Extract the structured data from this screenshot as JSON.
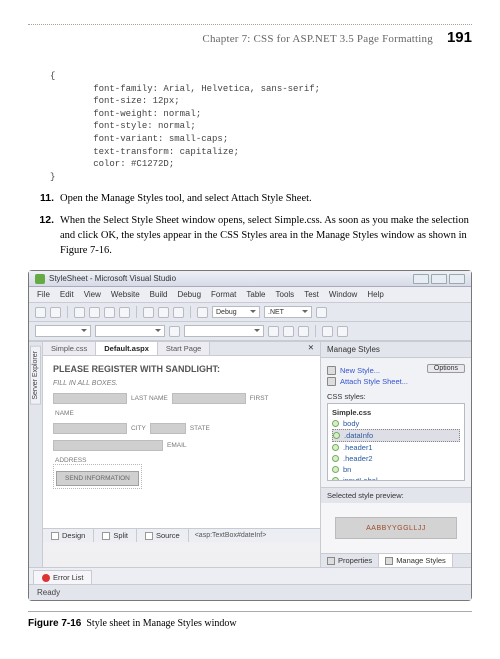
{
  "header": {
    "chapter": "Chapter 7:   CSS for ASP.NET 3.5 Page Formatting",
    "page_number": "191"
  },
  "code": "{\n        font-family: Arial, Helvetica, sans-serif;\n        font-size: 12px;\n        font-weight: normal;\n        font-style: normal;\n        font-variant: small-caps;\n        text-transform: capitalize;\n        color: #C1272D;\n}",
  "steps": [
    {
      "n": "11.",
      "text": "Open the Manage Styles tool, and select Attach Style Sheet."
    },
    {
      "n": "12.",
      "text": "When the Select Style Sheet window opens, select Simple.css. As soon as you make the selection and click OK, the styles appear in the CSS Styles area in the Manage Styles window as shown in Figure 7-16."
    }
  ],
  "vs": {
    "title": "StyleSheet - Microsoft Visual Studio",
    "menus": [
      "File",
      "Edit",
      "View",
      "Website",
      "Build",
      "Debug",
      "Format",
      "Table",
      "Tools",
      "Test",
      "Window",
      "Help"
    ],
    "toolbar_debug": "Debug",
    "toolbar_target": ".NET",
    "sideRail": "Server Explorer",
    "tabs": [
      "Simple.css",
      "Default.aspx",
      "Start Page"
    ],
    "activeTab": 1,
    "form": {
      "heading": "PLEASE REGISTER WITH SANDLIGHT:",
      "hint": "FILL IN ALL BOXES.",
      "labels": {
        "lname": "LAST NAME",
        "fname": "FIRST",
        "name": "NAME",
        "city": "CITY",
        "state": "STATE",
        "email": "EMAIL",
        "address": "ADDRESS"
      },
      "submit": "SEND INFORMATION"
    },
    "views": {
      "design": "Design",
      "split": "Split",
      "source": "Source"
    },
    "crumb": "<asp:TextBox#dateInf>",
    "panel": {
      "title": "Manage Styles",
      "newStyle": "New Style...",
      "attach": "Attach Style Sheet...",
      "options": "Options",
      "cssStylesLabel": "CSS styles:",
      "items": [
        "Simple.css",
        "body",
        ".dataInfo",
        ".header1",
        ".header2",
        "bn",
        "inputLabel"
      ],
      "previewTitle": "Selected style preview:",
      "previewText": "AABBYYGGLLJJ"
    },
    "propTabs": {
      "props": "Properties",
      "manage": "Manage Styles"
    },
    "errorList": "Error List",
    "status": "Ready"
  },
  "caption": {
    "label": "Figure 7-16",
    "text": "Style sheet in Manage Styles window"
  }
}
